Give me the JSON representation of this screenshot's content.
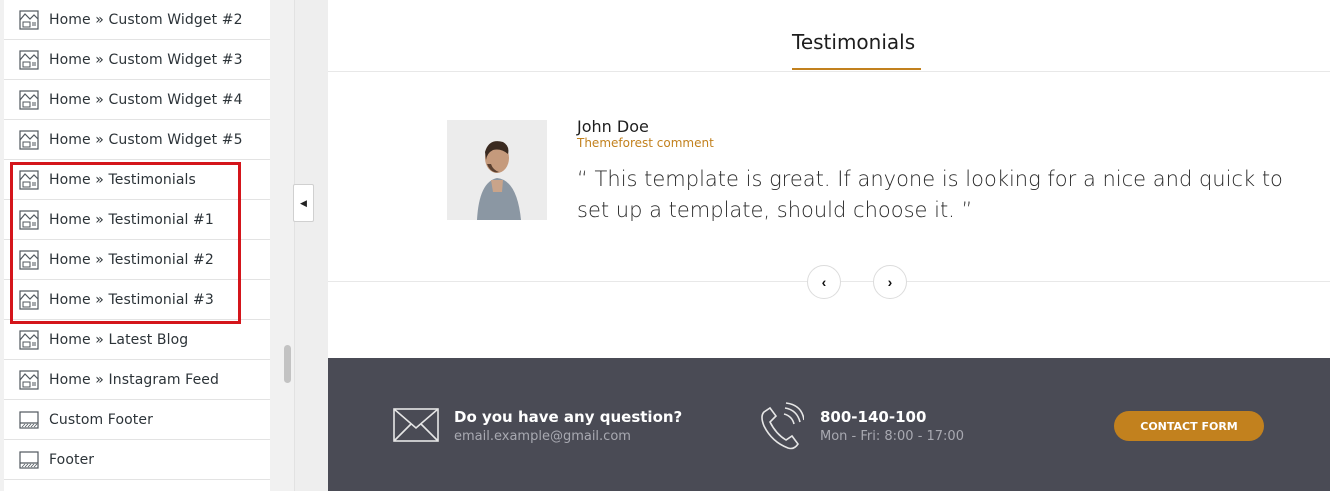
{
  "sections": [
    {
      "label": "Home » Custom Widget #2",
      "icon": "layout-section-icon"
    },
    {
      "label": "Home » Custom Widget #3",
      "icon": "layout-section-icon"
    },
    {
      "label": "Home » Custom Widget #4",
      "icon": "layout-section-icon"
    },
    {
      "label": "Home » Custom Widget #5",
      "icon": "layout-section-icon"
    },
    {
      "label": "Home » Testimonials",
      "icon": "layout-section-icon"
    },
    {
      "label": "Home » Testimonial #1",
      "icon": "layout-section-icon"
    },
    {
      "label": "Home » Testimonial #2",
      "icon": "layout-section-icon"
    },
    {
      "label": "Home » Testimonial #3",
      "icon": "layout-section-icon"
    },
    {
      "label": "Home » Latest Blog",
      "icon": "layout-section-icon"
    },
    {
      "label": "Home » Instagram Feed",
      "icon": "layout-section-icon"
    },
    {
      "label": "Custom Footer",
      "icon": "footer-layout-icon"
    },
    {
      "label": "Footer",
      "icon": "footer-layout-icon"
    }
  ],
  "collapse_glyph": "◀",
  "testimonials": {
    "title": "Testimonials",
    "author": "John Doe",
    "role": "Themeforest comment",
    "quote": "“ This template is great. If anyone is looking for a nice and quick to set up a template, should choose it. ”",
    "prev_glyph": "‹",
    "next_glyph": "›"
  },
  "footer": {
    "question": "Do you have any question?",
    "email": "email.example@gmail.com",
    "phone": "800-140-100",
    "hours": "Mon - Fri: 8:00 - 17:00",
    "contact_button": "CONTACT FORM"
  },
  "colors": {
    "accent": "#c2811e",
    "highlight": "#d4151b",
    "footer_bg": "#4a4b55"
  }
}
